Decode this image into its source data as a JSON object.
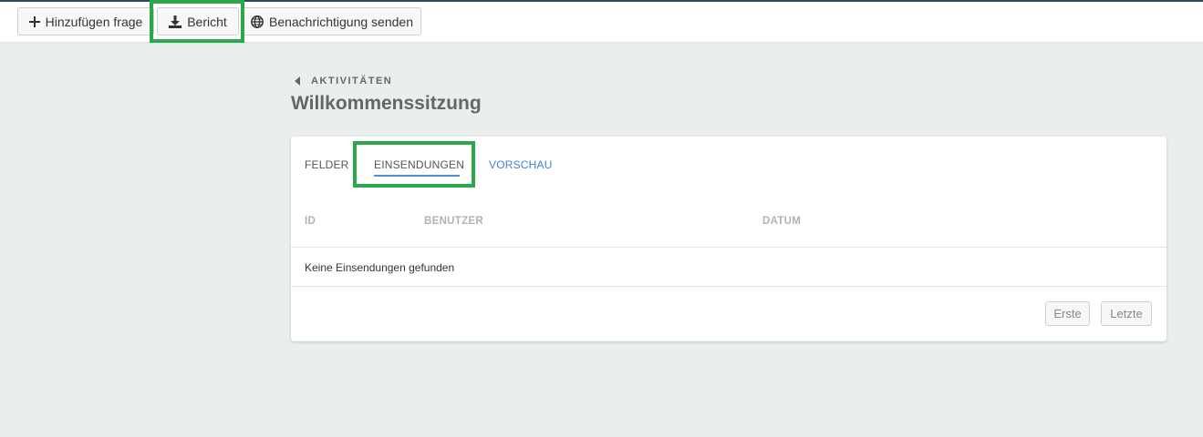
{
  "toolbar": {
    "add_question_label": "Hinzufügen frage",
    "report_label": "Bericht",
    "send_notification_label": "Benachrichtigung senden"
  },
  "breadcrumb": {
    "back_label": "AKTIVITÄTEN"
  },
  "page": {
    "title": "Willkommenssitzung"
  },
  "tabs": [
    {
      "label": "FELDER",
      "active": false
    },
    {
      "label": "EINSENDUNGEN",
      "active": true
    },
    {
      "label": "VORSCHAU",
      "active": false
    }
  ],
  "table": {
    "columns": [
      "ID",
      "BENUTZER",
      "DATUM"
    ],
    "empty_message": "Keine Einsendungen gefunden"
  },
  "pagination": {
    "first_label": "Erste",
    "last_label": "Letzte"
  },
  "colors": {
    "accent": "#3d86d6",
    "highlight": "#2aa84a",
    "background": "#ebeeef"
  }
}
